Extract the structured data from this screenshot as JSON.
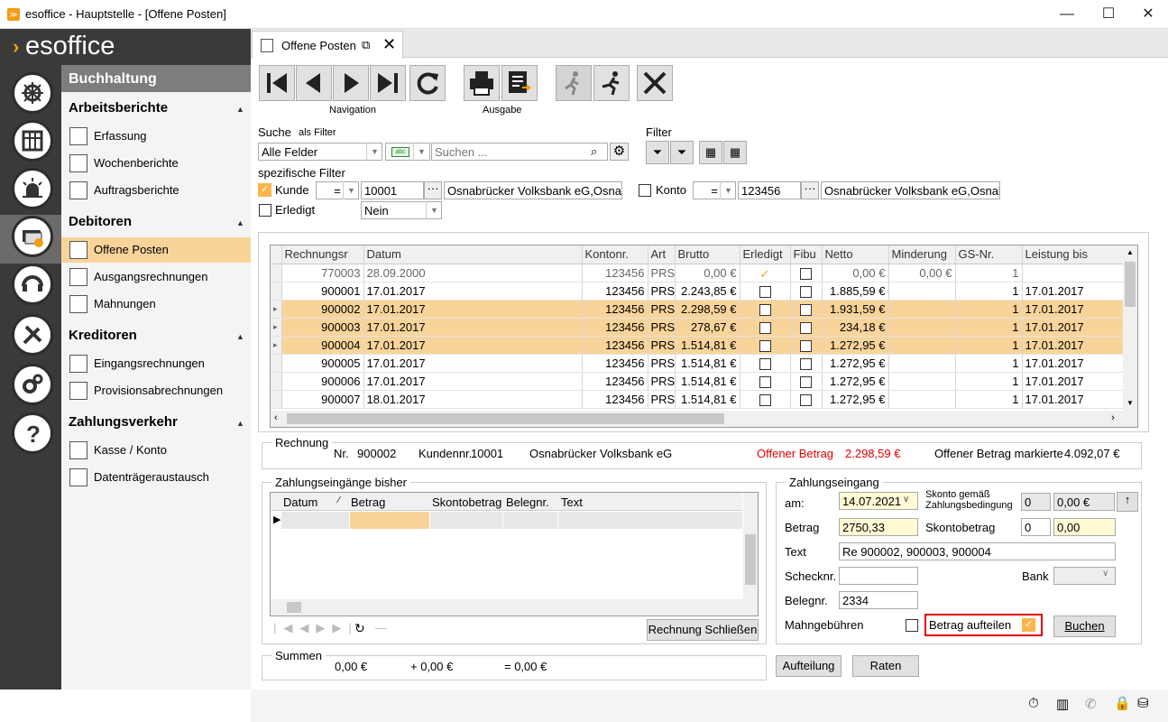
{
  "window": {
    "title": "esoffice - Hauptstelle - [Offene Posten]"
  },
  "logo": "esoffice",
  "nav": {
    "header": "Buchhaltung",
    "sections": [
      {
        "title": "Arbeitsberichte",
        "items": [
          "Erfassung",
          "Wochenberichte",
          "Auftragsberichte"
        ]
      },
      {
        "title": "Debitoren",
        "items": [
          "Offene Posten",
          "Ausgangsrechnungen",
          "Mahnungen"
        ]
      },
      {
        "title": "Kreditoren",
        "items": [
          "Eingangsrechnungen",
          "Provisionsabrechnungen"
        ]
      },
      {
        "title": "Zahlungsverkehr",
        "items": [
          "Kasse / Konto",
          "Datenträgeraustausch"
        ]
      }
    ]
  },
  "tab": {
    "label": "Offene Posten"
  },
  "toolbar": {
    "navigation_label": "Navigation",
    "ausgabe_label": "Ausgabe"
  },
  "search": {
    "label": "Suche",
    "as_filter": "als Filter",
    "field": "Alle Felder",
    "placeholder": "Suchen ...",
    "filter_label": "Filter",
    "specific_label": "spezifische Filter",
    "kunde_label": "Kunde",
    "kunde_op": "=",
    "kunde_value": "10001",
    "kunde_name": "Osnabrücker Volksbank eG,Osnab",
    "konto_label": "Konto",
    "konto_op": "=",
    "konto_value": "123456",
    "konto_name": "Osnabrücker Volksbank eG,Osnab",
    "erledigt_label": "Erledigt",
    "erledigt_value": "Nein"
  },
  "grid": {
    "headers": [
      "Rechnungsr",
      "Datum",
      "Kontonr.",
      "Art",
      "Brutto",
      "Erledigt",
      "Fibu",
      "Netto",
      "Minderung",
      "GS-Nr.",
      "Leistung bis"
    ],
    "rows": [
      {
        "nr": "770003",
        "datum": "28.09.2000",
        "konto": "123456",
        "art": "PRS",
        "brutto": "0,00 €",
        "erledigt": true,
        "netto": "0,00 €",
        "minderung": "0,00 €",
        "gs": "1",
        "leistung": "",
        "state": "grey"
      },
      {
        "nr": "900001",
        "datum": "17.01.2017",
        "konto": "123456",
        "art": "PRS",
        "brutto": "2.243,85 €",
        "erledigt": false,
        "netto": "1.885,59 €",
        "minderung": "",
        "gs": "1",
        "leistung": "17.01.2017",
        "state": ""
      },
      {
        "nr": "900002",
        "datum": "17.01.2017",
        "konto": "123456",
        "art": "PRS",
        "brutto": "2.298,59 €",
        "erledigt": false,
        "netto": "1.931,59 €",
        "minderung": "",
        "gs": "1",
        "leistung": "17.01.2017",
        "state": "sel"
      },
      {
        "nr": "900003",
        "datum": "17.01.2017",
        "konto": "123456",
        "art": "PRS",
        "brutto": "278,67 €",
        "erledigt": false,
        "netto": "234,18 €",
        "minderung": "",
        "gs": "1",
        "leistung": "17.01.2017",
        "state": "sel"
      },
      {
        "nr": "900004",
        "datum": "17.01.2017",
        "konto": "123456",
        "art": "PRS",
        "brutto": "1.514,81 €",
        "erledigt": false,
        "netto": "1.272,95 €",
        "minderung": "",
        "gs": "1",
        "leistung": "17.01.2017",
        "state": "sel"
      },
      {
        "nr": "900005",
        "datum": "17.01.2017",
        "konto": "123456",
        "art": "PRS",
        "brutto": "1.514,81 €",
        "erledigt": false,
        "netto": "1.272,95 €",
        "minderung": "",
        "gs": "1",
        "leistung": "17.01.2017",
        "state": ""
      },
      {
        "nr": "900006",
        "datum": "17.01.2017",
        "konto": "123456",
        "art": "PRS",
        "brutto": "1.514,81 €",
        "erledigt": false,
        "netto": "1.272,95 €",
        "minderung": "",
        "gs": "1",
        "leistung": "17.01.2017",
        "state": ""
      },
      {
        "nr": "900007",
        "datum": "18.01.2017",
        "konto": "123456",
        "art": "PRS",
        "brutto": "1.514,81 €",
        "erledigt": false,
        "netto": "1.272,95 €",
        "minderung": "",
        "gs": "1",
        "leistung": "17.01.2017",
        "state": ""
      }
    ]
  },
  "rechnung": {
    "legend": "Rechnung",
    "nr_label": "Nr.",
    "nr": "900002",
    "kundennr_label": "Kundennr.",
    "kundennr": "10001",
    "name": "Osnabrücker Volksbank eG",
    "offen_label": "Offener Betrag",
    "offen": "2.298,59 €",
    "markiert_label": "Offener Betrag markierte",
    "markiert": "4.092,07 €"
  },
  "bisher": {
    "legend": "Zahlungseingänge bisher",
    "headers": [
      "Datum",
      "Betrag",
      "Skontobetrag",
      "Belegnr.",
      "Text"
    ],
    "close_button": "Rechnung Schließen"
  },
  "summen": {
    "legend": "Summen",
    "v1": "0,00 €",
    "v2": "+ 0,00 €",
    "v3": "= 0,00 €"
  },
  "eingang": {
    "legend": "Zahlungseingang",
    "am_label": "am:",
    "am": "14.07.2021",
    "skonto_cond_label": "Skonto gemäß Zahlungsbedingung",
    "skonto_cond_pct": "0",
    "skonto_cond_amt": "0,00 €",
    "betrag_label": "Betrag",
    "betrag": "2750,33",
    "skontobetrag_label": "Skontobetrag",
    "skonto_pct": "0",
    "skonto_amt": "0,00",
    "text_label": "Text",
    "text": "Re 900002, 900003, 900004",
    "scheck_label": "Schecknr.",
    "scheck": "",
    "bank_label": "Bank",
    "beleg_label": "Belegnr.",
    "beleg": "2334",
    "mahn_label": "Mahngebühren",
    "aufteilen_label": "Betrag aufteilen",
    "aufteilen_checked": true,
    "buchen": "Buchen",
    "aufteilung": "Aufteilung",
    "raten": "Raten"
  }
}
